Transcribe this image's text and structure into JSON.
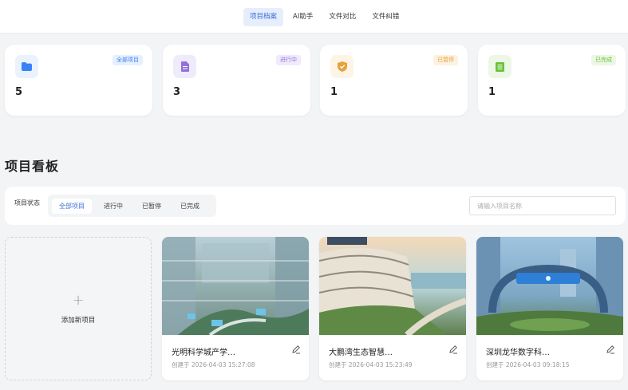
{
  "nav": {
    "tabs": [
      "项目档案",
      "AI助手",
      "文件对比",
      "文件纠错"
    ]
  },
  "stats": [
    {
      "icon": "folder-icon",
      "badge": "全部项目",
      "value": "5"
    },
    {
      "icon": "document-icon",
      "badge": "进行中",
      "value": "3"
    },
    {
      "icon": "shield-icon",
      "badge": "已暂停",
      "value": "1"
    },
    {
      "icon": "list-icon",
      "badge": "已完成",
      "value": "1"
    }
  ],
  "board": {
    "title": "项目看板",
    "status_label": "项目状态",
    "filters": [
      "全部项目",
      "进行中",
      "已暂停",
      "已完成"
    ],
    "search_placeholder": "请输入项目名称",
    "search_value": ""
  },
  "add_project": {
    "label": "添加新项目",
    "icon": "plus-icon"
  },
  "projects": [
    {
      "name": "光明科学城产学…",
      "created": "创建于 2026-04-03 15:27:08"
    },
    {
      "name": "大鹏湾生态智慧…",
      "created": "创建于 2026-04-03 15:23:49"
    },
    {
      "name": "深圳龙华数字科…",
      "created": "创建于 2026-04-03 09:18:15"
    }
  ],
  "colors": {
    "accent": "#3b6fd6",
    "blue_bg": "#eaf2fd",
    "purple": "#9370db",
    "orange": "#e6a23c",
    "green": "#67c23a"
  }
}
